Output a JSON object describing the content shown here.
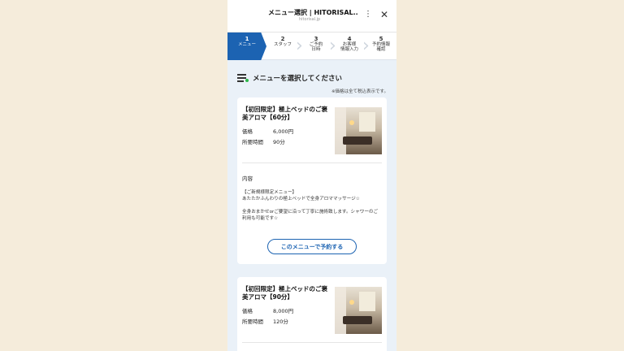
{
  "browser": {
    "title": "メニュー選択 | HITORISAL...",
    "url": "hitorisal.jp",
    "menu_icon": "more-vertical-icon",
    "close_icon": "close-icon"
  },
  "steps": [
    {
      "num": "1",
      "label": "メニュー",
      "active": true
    },
    {
      "num": "2",
      "label": "スタッフ",
      "active": false
    },
    {
      "num": "3",
      "label": "ご予約\n日時",
      "active": false
    },
    {
      "num": "4",
      "label": "お客様\n情報入力",
      "active": false
    },
    {
      "num": "5",
      "label": "予約情報\n確認",
      "active": false
    }
  ],
  "section": {
    "title": "メニューを選択してください",
    "tax_note": "※価格は全て税込表示です。"
  },
  "labels": {
    "price": "価格",
    "duration": "所要時間",
    "content": "内容",
    "book_button": "このメニューで予約する"
  },
  "menus": [
    {
      "name": "【初回限定】極上ベッドのご褒美アロマ【60分】",
      "price": "6,000円",
      "duration": "90分",
      "description": "【ご新規様限定メニュー】\nあたたかふんわりの極上ベッドで全身アロママッサージ☆\n\n全身おまかせorご要望に沿って丁寧に施術致します。シャワーのご利用も可能です☆"
    },
    {
      "name": "【初回限定】極上ベッドのご褒美アロマ【90分】",
      "price": "8,000円",
      "duration": "120分"
    }
  ],
  "colors": {
    "accent": "#1c63b2",
    "page_bg": "#f5ecdb",
    "panel_bg": "#eaf1f8",
    "status_dot": "#2db84a"
  }
}
